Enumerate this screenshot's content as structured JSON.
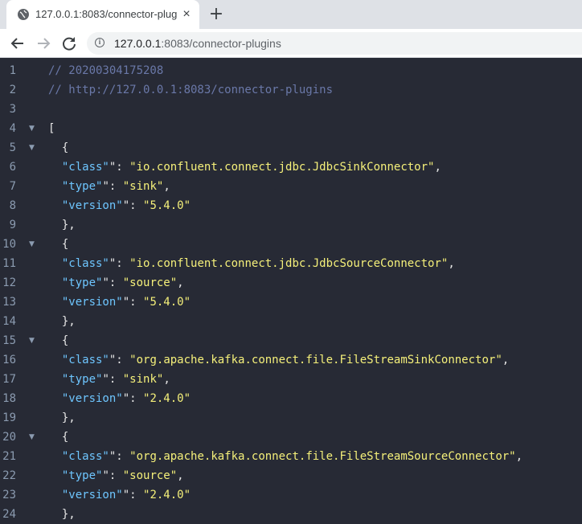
{
  "browser": {
    "tab_title": "127.0.0.1:8083/connector-plugins",
    "tab_close": "×",
    "new_tab": "+",
    "url_host": "127.0.0.1",
    "url_rest": ":8083/connector-plugins",
    "icons": {
      "favicon": "globe-icon",
      "back": "back-arrow-icon",
      "forward": "forward-arrow-icon",
      "reload": "reload-icon",
      "info": "info-icon"
    }
  },
  "lines": [
    {
      "n": "1",
      "text": "// 20200304175208"
    },
    {
      "n": "2",
      "text": "// http://127.0.0.1:8083/connector-plugins"
    },
    {
      "n": "3",
      "text": ""
    },
    {
      "n": "4",
      "fold": "▼",
      "text": "["
    },
    {
      "n": "5",
      "fold": "▼",
      "text": "  {"
    },
    {
      "n": "6",
      "k": "class",
      "v": "io.confluent.connect.jdbc.JdbcSinkConnector",
      "comma": ","
    },
    {
      "n": "7",
      "k": "type",
      "v": "sink",
      "comma": ","
    },
    {
      "n": "8",
      "k": "version",
      "v": "5.4.0",
      "comma": ""
    },
    {
      "n": "9",
      "text": "  },"
    },
    {
      "n": "10",
      "fold": "▼",
      "text": "  {"
    },
    {
      "n": "11",
      "k": "class",
      "v": "io.confluent.connect.jdbc.JdbcSourceConnector",
      "comma": ","
    },
    {
      "n": "12",
      "k": "type",
      "v": "source",
      "comma": ","
    },
    {
      "n": "13",
      "k": "version",
      "v": "5.4.0",
      "comma": ""
    },
    {
      "n": "14",
      "text": "  },"
    },
    {
      "n": "15",
      "fold": "▼",
      "text": "  {"
    },
    {
      "n": "16",
      "k": "class",
      "v": "org.apache.kafka.connect.file.FileStreamSinkConnector",
      "comma": ","
    },
    {
      "n": "17",
      "k": "type",
      "v": "sink",
      "comma": ","
    },
    {
      "n": "18",
      "k": "version",
      "v": "2.4.0",
      "comma": ""
    },
    {
      "n": "19",
      "text": "  },"
    },
    {
      "n": "20",
      "fold": "▼",
      "text": "  {"
    },
    {
      "n": "21",
      "k": "class",
      "v": "org.apache.kafka.connect.file.FileStreamSourceConnector",
      "comma": ","
    },
    {
      "n": "22",
      "k": "type",
      "v": "source",
      "comma": ","
    },
    {
      "n": "23",
      "k": "version",
      "v": "2.4.0",
      "comma": ""
    },
    {
      "n": "24",
      "text": "  },"
    }
  ]
}
